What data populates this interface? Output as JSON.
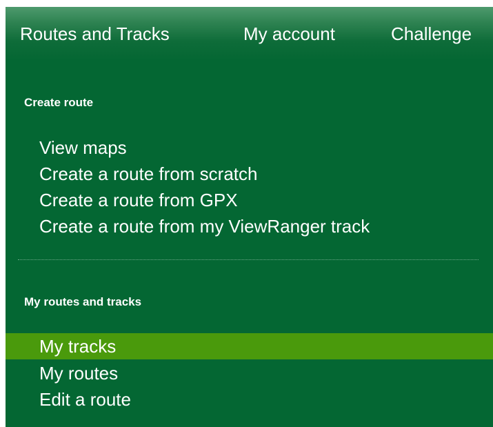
{
  "top_nav": {
    "items": [
      "Routes and Tracks",
      "My account",
      "Challenge"
    ]
  },
  "create_section": {
    "title": "Create route",
    "items": [
      "View maps",
      "Create a route from scratch",
      "Create a route from GPX",
      "Create a route from my ViewRanger track"
    ]
  },
  "my_section": {
    "title": "My routes and tracks",
    "items": [
      "My tracks",
      "My routes",
      "Edit a route"
    ],
    "active_item": "My tracks"
  },
  "colors": {
    "background": "#046733",
    "active_highlight": "#4a9a0c",
    "text": "#ffffff"
  }
}
